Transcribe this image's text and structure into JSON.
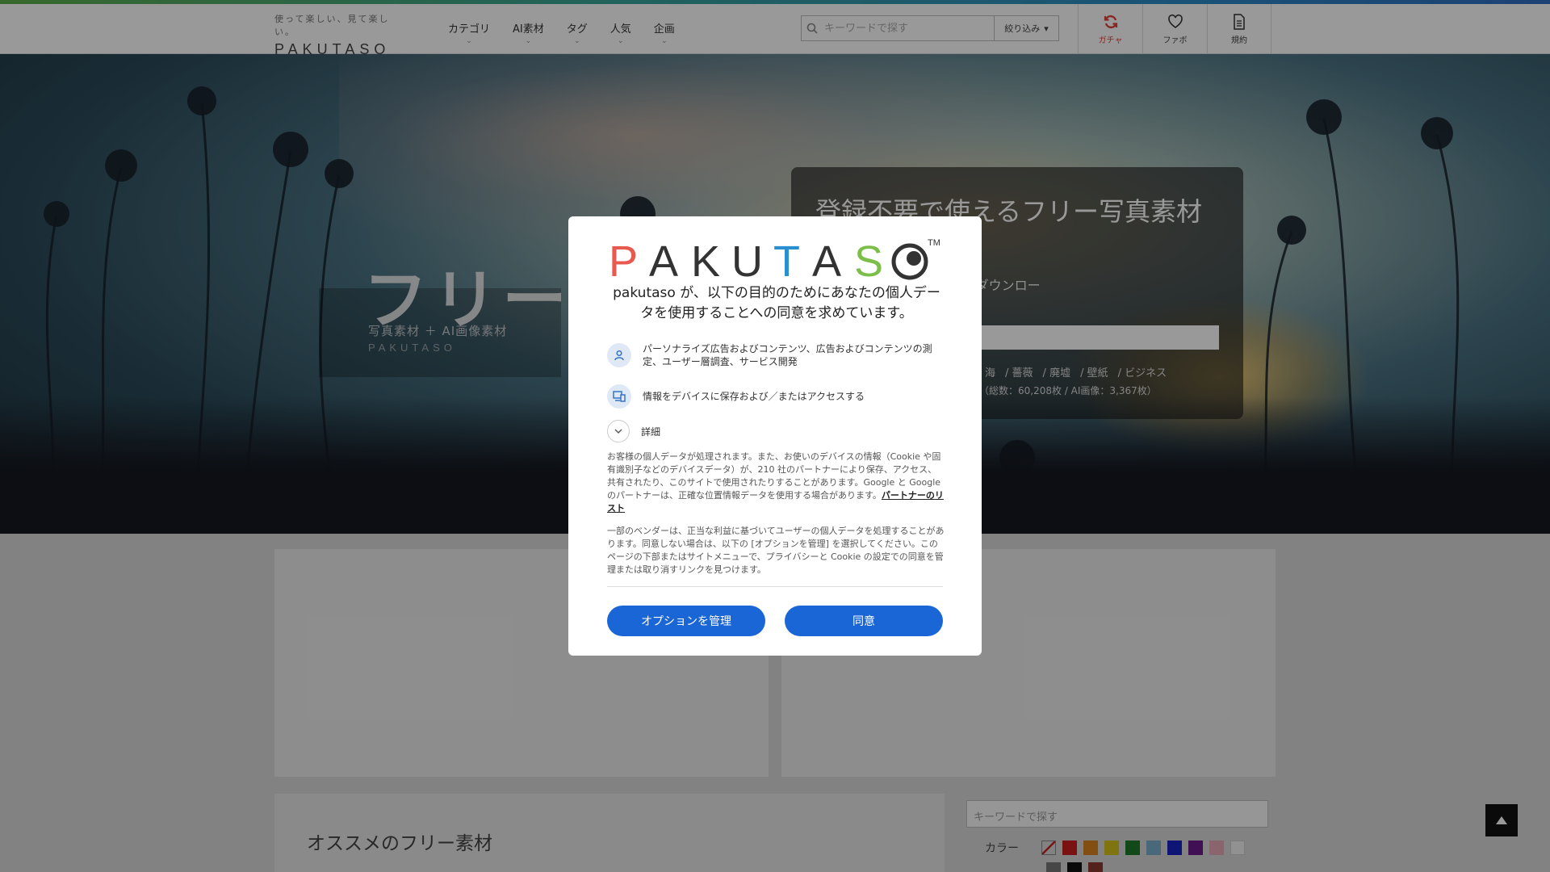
{
  "header": {
    "logo_tagline": "使って楽しい、見て楽しい。",
    "logo_word": "PAKUTASO",
    "nav": [
      "カテゴリ",
      "AI素材",
      "タグ",
      "人気",
      "企画"
    ],
    "search_placeholder": "キーワードで探す",
    "filter_label": "絞り込み",
    "icons": [
      {
        "label": "ガチャ",
        "icon": "refresh-icon"
      },
      {
        "label": "ファボ",
        "icon": "heart-icon"
      },
      {
        "label": "規約",
        "icon": "document-icon"
      }
    ]
  },
  "hero": {
    "title": "フリー",
    "subtitle": "写真素材 ＋ AI画像素材",
    "brand": "PAKUTASO",
    "panel_title": "登録不要で使えるフリー写真素材",
    "panel_desc": "用利用OK・会員登録なしでダウンロー",
    "tags": [
      "海",
      "薔薇",
      "廃墟",
      "壁紙",
      "ビジネス"
    ],
    "stats": "（総数：60,208枚 / AI画像：3,367枚）"
  },
  "content": {
    "recommended_title": "オススメのフリー素材",
    "side_search_placeholder": "キーワードで探す",
    "color_label": "カラー",
    "swatches_row1": [
      "#cc1f1f",
      "#d9821e",
      "#d4c21a",
      "#1f7a2a",
      "#7ab0cc",
      "#1a23c2",
      "#6b1a8c",
      "#e6a8b8",
      "#f2f2f2"
    ],
    "swatches_row2": [
      "#777777",
      "#111111",
      "#8c3a2f"
    ]
  },
  "modal": {
    "logo_text": "PAKUTASO",
    "heading": "pakutaso が、以下の目的のためにあなたの個人データを使用することへの同意を求めています。",
    "purposes": [
      {
        "text": "パーソナライズ広告およびコンテンツ、広告およびコンテンツの測定、ユーザー層調査、サービス開発",
        "icon": "person-icon"
      },
      {
        "text": "情報をデバイスに保存および／またはアクセスする",
        "icon": "devices-icon"
      }
    ],
    "details_label": "詳細",
    "para1": "お客様の個人データが処理されます。また、お使いのデバイスの情報（Cookie や固有識別子などのデバイスデータ）が、210 社のパートナーにより保存、アクセス、共有されたり、このサイトで使用されたりすることがあります。Google と Google のパートナーは、正確な位置情報データを使用する場合があります。",
    "partners_link": "パートナーのリスト",
    "para2": "一部のベンダーは、正当な利益に基づいてユーザーの個人データを処理することがあります。同意しない場合は、以下の [オプションを管理] を選択してください。このページの下部またはサイトメニューで、プライバシーと Cookie の設定での同意を管理または取り消すリンクを見つけます。",
    "manage_button": "オプションを管理",
    "accept_button": "同意"
  }
}
